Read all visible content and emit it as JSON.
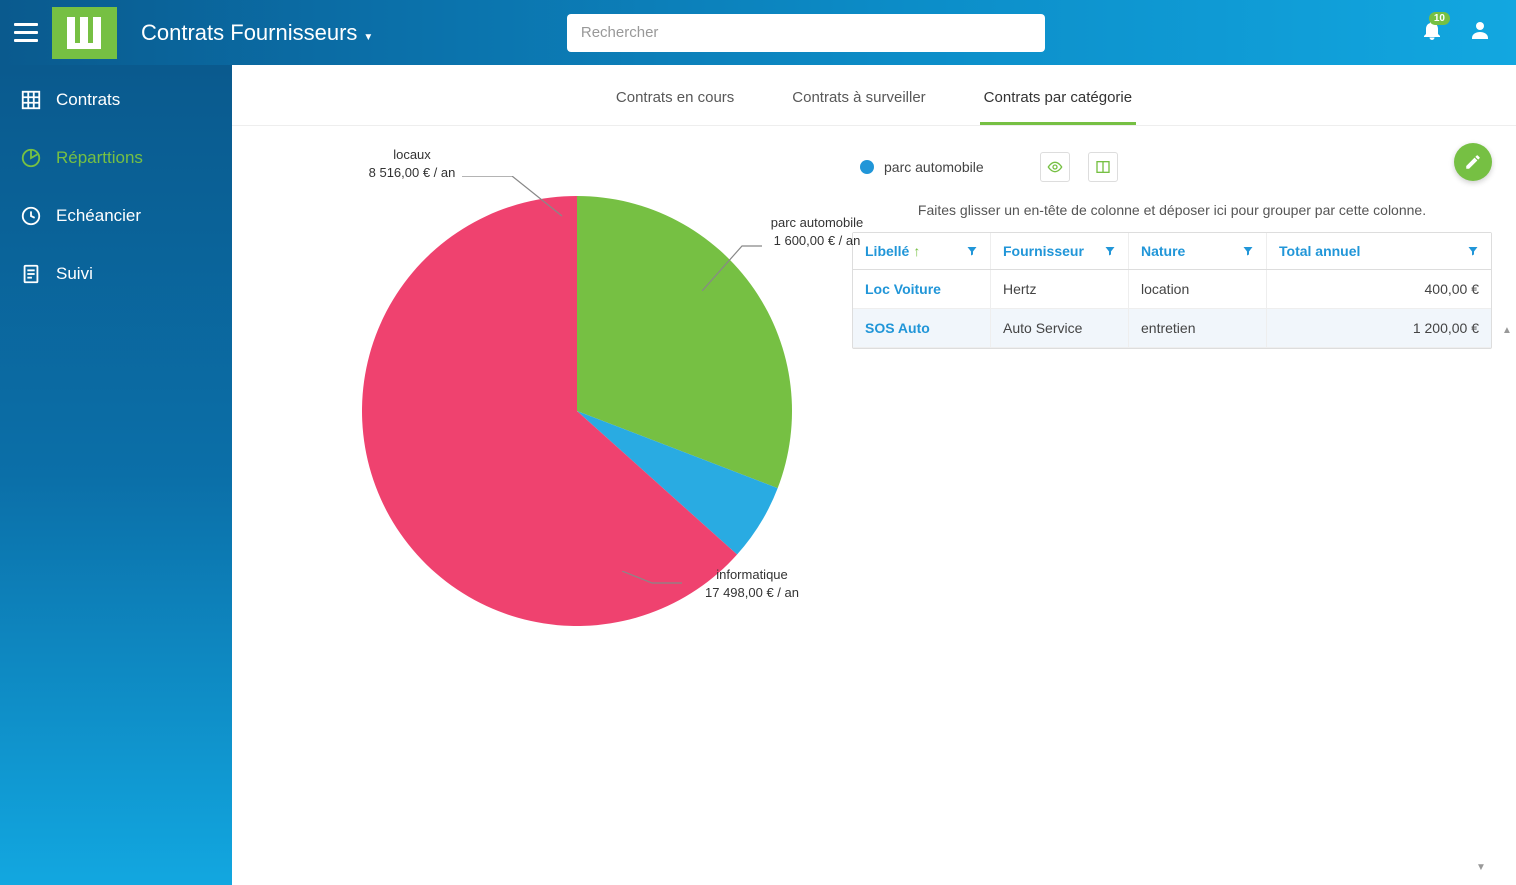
{
  "header": {
    "title": "Contrats Fournisseurs",
    "search_placeholder": "Rechercher",
    "badge": "10"
  },
  "sidebar": {
    "items": [
      {
        "label": "Contrats"
      },
      {
        "label": "Réparttions"
      },
      {
        "label": "Echéancier"
      },
      {
        "label": "Suivi"
      }
    ]
  },
  "tabs": [
    {
      "label": "Contrats en cours"
    },
    {
      "label": "Contrats à surveiller"
    },
    {
      "label": "Contrats par catégorie"
    }
  ],
  "chart_data": {
    "type": "pie",
    "title": "",
    "series": [
      {
        "name": "locaux",
        "value": 8516.0,
        "amount_text": "8 516,00 € / an",
        "color": "#76c043"
      },
      {
        "name": "parc automobile",
        "value": 1600.0,
        "amount_text": "1 600,00 € / an",
        "color": "#29abe2"
      },
      {
        "name": "informatique",
        "value": 17498.0,
        "amount_text": "17 498,00 € / an",
        "color": "#ef426f"
      }
    ]
  },
  "legend": {
    "selected": "parc automobile"
  },
  "table": {
    "group_hint": "Faites glisser un en-tête de colonne et déposer ici pour grouper par cette colonne.",
    "columns": [
      "Libellé",
      "Fournisseur",
      "Nature",
      "Total annuel"
    ],
    "rows": [
      {
        "libelle": "Loc Voiture",
        "fournisseur": "Hertz",
        "nature": "location",
        "total": "400,00 €"
      },
      {
        "libelle": "SOS Auto",
        "fournisseur": "Auto Service",
        "nature": "entretien",
        "total": "1 200,00 €"
      }
    ]
  }
}
